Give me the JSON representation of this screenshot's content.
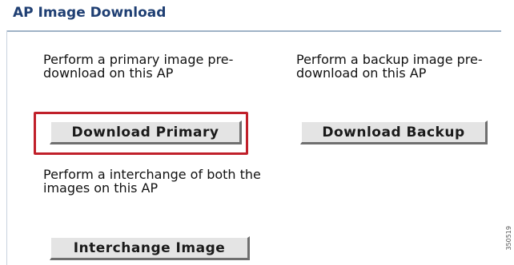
{
  "section": {
    "title": "AP Image Download"
  },
  "primary": {
    "description": "Perform a primary image pre-download on this AP",
    "button_label": "Download Primary"
  },
  "backup": {
    "description": "Perform a backup image pre-download on this AP",
    "button_label": "Download Backup"
  },
  "interchange": {
    "description": "Perform a interchange of both the images on this AP",
    "button_label": "Interchange Image"
  },
  "annotation": {
    "highlight_color": "#c0202a",
    "figure_code": "350519"
  },
  "colors": {
    "title": "#1f3f73",
    "rule": "#9fb2c6",
    "button_face": "#e4e4e4"
  }
}
